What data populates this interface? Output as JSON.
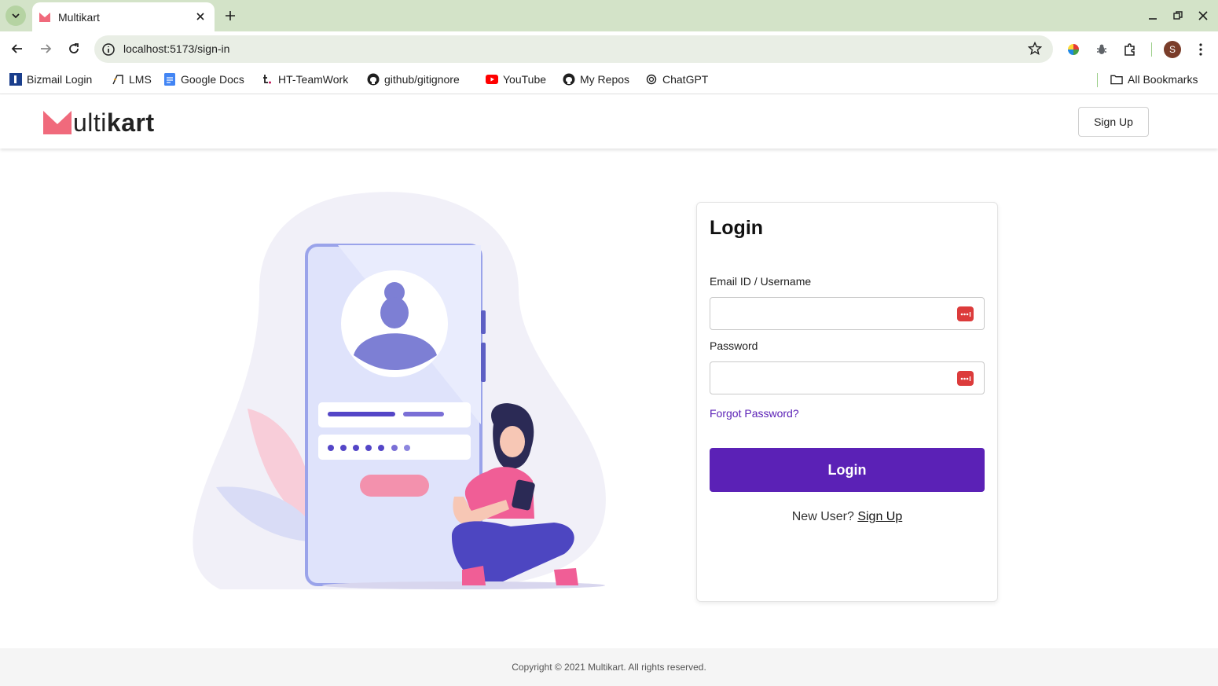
{
  "browser": {
    "tab_title": "Multikart",
    "url": "localhost:5173/sign-in",
    "profile_initial": "S",
    "bookmarks": [
      {
        "label": "Bizmail Login",
        "icon": "bizmail-icon"
      },
      {
        "label": "LMS",
        "icon": "lms-icon"
      },
      {
        "label": "Google Docs",
        "icon": "google-docs-icon"
      },
      {
        "label": "HT-TeamWork",
        "icon": "teamwork-icon"
      },
      {
        "label": "github/gitignore",
        "icon": "github-icon"
      },
      {
        "label": "YouTube",
        "icon": "youtube-icon"
      },
      {
        "label": "My Repos",
        "icon": "github-icon"
      },
      {
        "label": "ChatGPT",
        "icon": "chatgpt-icon"
      }
    ],
    "all_bookmarks": "All Bookmarks"
  },
  "header": {
    "logo_text_light": "ulti",
    "logo_text_bold": "kart",
    "signup_label": "Sign Up"
  },
  "login": {
    "title": "Login",
    "email_label": "Email ID / Username",
    "email_value": "",
    "password_label": "Password",
    "password_value": "",
    "forgot_label": "Forgot Password?",
    "submit_label": "Login",
    "new_user_text": "New User?",
    "signup_link": "Sign Up"
  },
  "footer": {
    "copyright": "Copyright © 2021 Multikart. All rights reserved."
  },
  "colors": {
    "primary": "#5b21b6",
    "brand_pink": "#f06a7c",
    "chrome_green": "#d3e3c8"
  }
}
